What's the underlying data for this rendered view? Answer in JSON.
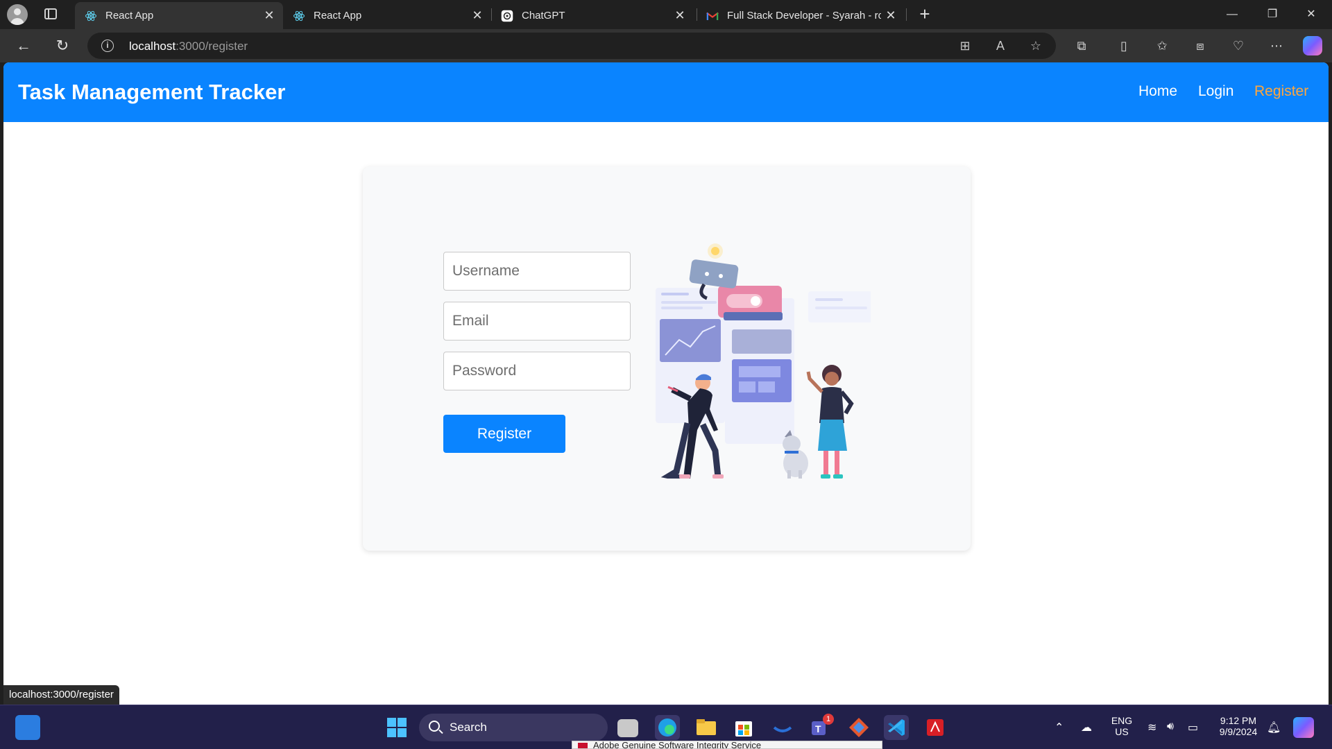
{
  "browser": {
    "tabs": [
      {
        "title": "React App",
        "icon": "react-icon",
        "active": true
      },
      {
        "title": "React App",
        "icon": "react-icon",
        "active": false
      },
      {
        "title": "ChatGPT",
        "icon": "chatgpt-icon",
        "active": false
      },
      {
        "title": "Full Stack Developer - Syarah - ro",
        "icon": "gmail-icon",
        "active": false
      }
    ],
    "address": {
      "host": "localhost",
      "path": ":3000/register"
    },
    "status_url": "localhost:3000/register"
  },
  "page": {
    "brand": "Task Management Tracker",
    "nav": {
      "home": "Home",
      "login": "Login",
      "register": "Register"
    },
    "nav_active_color": "#ffa63d",
    "accent_color": "#0a84ff",
    "form": {
      "username_placeholder": "Username",
      "email_placeholder": "Email",
      "password_placeholder": "Password",
      "submit_label": "Register"
    }
  },
  "taskbar": {
    "search_label": "Search",
    "teams_badge": "1",
    "lang_top": "ENG",
    "lang_bottom": "US",
    "time": "9:12 PM",
    "date": "9/9/2024",
    "notification_text": "Adobe Genuine Software Integrity Service"
  }
}
